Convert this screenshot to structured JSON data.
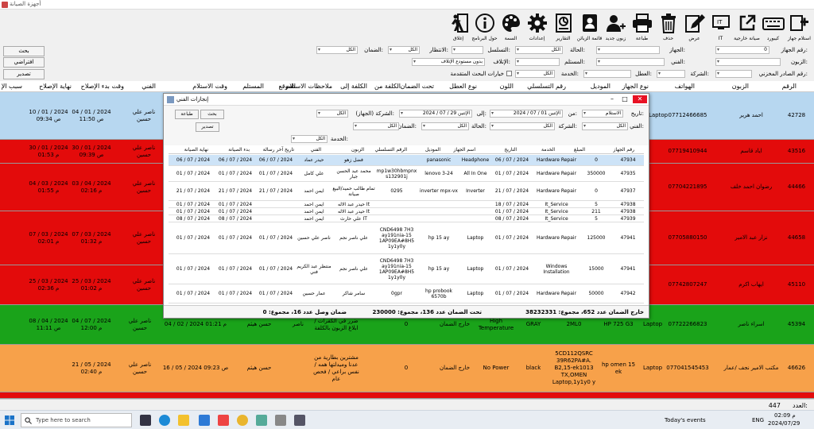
{
  "window": {
    "title": "أجهزة الصيانة"
  },
  "toolbar": [
    {
      "label": "استلام جهاز",
      "icon": "add-plus-icon"
    },
    {
      "label": "كيبورد",
      "icon": "keyboard-icon"
    },
    {
      "label": "صيانة خارجية",
      "icon": "external-link-icon"
    },
    {
      "label": "IT",
      "icon": "it-monitor-icon"
    },
    {
      "label": "عرض",
      "icon": "edit-pen-icon"
    },
    {
      "label": "حذف",
      "icon": "trash-icon"
    },
    {
      "label": "طباعة",
      "icon": "printer-icon"
    },
    {
      "label": "زبون جديد",
      "icon": "add-user-icon"
    },
    {
      "label": "قائمة الزبائن",
      "icon": "contacts-icon"
    },
    {
      "label": "التقارير",
      "icon": "report-chart-icon"
    },
    {
      "label": "إعدادات",
      "icon": "gear-icon"
    },
    {
      "label": "السمة",
      "icon": "palette-icon"
    },
    {
      "label": "حول البرنامج",
      "icon": "info-icon"
    },
    {
      "label": "إغلاق",
      "icon": "exit-door-icon"
    }
  ],
  "filters": {
    "search_btn": "بحث",
    "default_btn": "افتراضي",
    "export_btn": "تصدير",
    "device_no_label": "رقم الجهاز:",
    "device_no_value": "0",
    "device_label": "الجهاز:",
    "status_label": "الحالة:",
    "status_value": "الكل",
    "sequence_label": "التسلسل:",
    "wait_label": "الانتظار:",
    "wait_value": "الكل",
    "warranty_label": "الضمان:",
    "warranty_value": "الكل",
    "customer_label": "الزبون:",
    "technician_label": "الفني:",
    "receiver_label": "المستلم:",
    "destroy_label": "الإتلاف:",
    "destroy_value": "بدون مستودع الإتلاف",
    "internal_no_label": "رقم الصادر المخزني:",
    "company_label": "الشركة:",
    "fault_label": "العطل:",
    "service_label": "الخدمة:",
    "service_value": "الكل",
    "advanced_label": "خيارات البحث المتقدمة"
  },
  "grid_headers": [
    "الرقم",
    "الزبون",
    "الهواتف",
    "نوع الجهاز",
    "الموديل",
    "رقم التسلسلي",
    "اللون",
    "نوع العطل",
    "تحت الضمان",
    "الكلفة من",
    "الكلفة إلى",
    "ملاحظات الاستلام",
    "الموقع",
    "المستلم",
    "وقت الاستلام",
    "الفني",
    "وقت بدء الإصلاح",
    "نهاية الإصلاح",
    "سبب الإ"
  ],
  "grid_rows": [
    {
      "color": "blue",
      "num": "42728",
      "customer": "احمد هرير",
      "phone": "07712466685",
      "type": "Laptop",
      "tech": "ناصر علي حسين",
      "start": "04 / 01 / 2024 11:50 ص",
      "end": "10 / 01 / 2024 09:34 ص"
    },
    {
      "color": "red",
      "num": "43516",
      "customer": "اياد قاسم",
      "phone": "07719410944",
      "type": "Laptop",
      "tech": "ناصر علي حسين",
      "start": "30 / 01 / 2024 09:39 ص",
      "end": "30 / 01 / 2024 01:53 م"
    },
    {
      "color": "red",
      "num": "44466",
      "customer": "رضوان احمد خلف",
      "phone": "07704221895",
      "type": "Laptop",
      "tech": "ناصر علي حسين",
      "start": "03 / 04 / 2024 02:16 م",
      "end": "04 / 03 / 2024 01:55 م"
    },
    {
      "color": "red",
      "num": "44658",
      "customer": "نزار عبد الامير",
      "phone": "07705880150",
      "type": "Laptop",
      "tech": "ناصر علي حسين",
      "start": "07 / 03 / 2024 01:32 م",
      "end": "07 / 03 / 2024 02:01 م"
    },
    {
      "color": "red",
      "num": "45110",
      "customer": "ايهاب اكرم",
      "phone": "07742807247",
      "type": "Laptop",
      "tech": "ناصر علي حسين",
      "start": "25 / 03 / 2024 01:02 م",
      "end": "25 / 03 / 2024 02:36 م"
    },
    {
      "color": "green",
      "num": "45394",
      "customer": "اسراء ناصر",
      "phone": "07722266823",
      "type": "Laptop",
      "model": "HP 725 G3",
      "serial": "2ML0",
      "colorv": "GRAY",
      "fault": "High Temperature",
      "warranty": "خارج الضمان",
      "cost": "0",
      "note": "ضرر في الكفرات / ابلاغ الزبون بالكلفة",
      "receiver": "حسن هيثم",
      "recv_time": "04 / 02 / 2024 01:21 م",
      "tech": "ناصر",
      "tech2": "ناصر علي حسين",
      "start": "04 / 07 / 2024 12:00 م",
      "end": "08 / 04 / 2024 11:11 ص"
    },
    {
      "color": "orange",
      "num": "46626",
      "customer": "مكتب الامير نجف /عمار",
      "phone": "077041545453",
      "type": "Laptop",
      "model": "hp omen 15 ek",
      "serial": "5CD112QSRC 39R62PA#A. B2,15-ek1013 TX,OMEN Laptop,1y1y0 y",
      "colorv": "black",
      "fault": "No Power",
      "warranty": "خارج الضمان",
      "cost": "0",
      "note": "مشترين بطارية من عدنا وميدلتها همه / نفس براعي / فحص عام",
      "receiver": "حسن هيثم",
      "recv_time": "16 / 05 / 2024 09:23 ص",
      "tech2": "ناصر علي حسين",
      "start": "21 / 05 / 2024 02:40 م"
    }
  ],
  "count": {
    "label": "العدد:",
    "value": "447"
  },
  "dialog": {
    "title": "إنجازات الفني",
    "search_btn": "بحث",
    "print_btn": "طباعة",
    "export_btn": "تصدير",
    "date_label": "تاريخ:",
    "date_value": "الاستلام",
    "from_label": "من:",
    "from_value": "الإثنين 01 / 07 / 2024",
    "to_label": "إلى:",
    "to_value": "الإثنين 29 / 07 / 2024",
    "company_device_label": "الشركة (الجهاز):",
    "company_device_value": "الكل",
    "technician_label": "الفني:",
    "technician_value": "الكل",
    "company_label": "الشركة:",
    "company_value": "الكل",
    "status_label": "الحالة:",
    "status_value": "الكل",
    "warranty_label": "الضمان:",
    "warranty_value": "الكل",
    "service_label": "الخدمة:",
    "service_value": "الكل",
    "headers": [
      "رقم الجهاز",
      "المبلغ",
      "الخدمة",
      "التاريخ",
      "اسم الجهاز",
      "الموديل",
      "الرقم التسلسلي",
      "الزبون",
      "الفني",
      "تاريخ آخر رسالة",
      "بدء الصيانة",
      "نهاية الصيانة"
    ],
    "rows": [
      {
        "num": "47934",
        "amount": "0",
        "service": "Hardware Repair",
        "date": "06 / 07 / 2024",
        "device": "Headphone",
        "model": "panasonic",
        "serial": "",
        "customer": "فضل زهو",
        "tech": "حيدر عماد",
        "msg": "06 / 07 / 2024",
        "start": "06 / 07 / 2024",
        "end": "06 / 07 / 2024",
        "sel": true
      },
      {
        "num": "47935",
        "amount": "350000",
        "service": "Hardware Repair",
        "date": "01 / 07 / 2024",
        "device": "All In One",
        "model": "lenovo 3-24",
        "serial": "mp1w30hbmpnx s132901j",
        "customer": "محمد عبد الحسن جبار",
        "tech": "علي كامل",
        "msg": "01 / 07 / 2024",
        "start": "01 / 07 / 2024",
        "end": "01 / 07 / 2024"
      },
      {
        "num": "47937",
        "amount": "0",
        "service": "Hardware Repair",
        "date": "21 / 07 / 2024",
        "device": "Inverter",
        "model": "inverter mpx-vx",
        "serial": "0295",
        "customer": "تمام طالب حميد/البيع صيانة",
        "tech": "ايمن احمد",
        "msg": "21 / 07 / 2024",
        "start": "21 / 07 / 2024",
        "end": "21 / 07 / 2024"
      },
      {
        "num": "47938",
        "amount": "5",
        "service": "It_Service",
        "date": "18 / 07 / 2024",
        "device": "",
        "model": "",
        "serial": "",
        "customer": "حيدر عبد الاله It",
        "tech": "ايمن احمد",
        "msg": "",
        "start": "01 / 07 / 2024",
        "end": "01 / 07 / 2024"
      },
      {
        "num": "47938",
        "amount": "211",
        "service": "It_Service",
        "date": "01 / 07 / 2024",
        "device": "",
        "model": "",
        "serial": "",
        "customer": "حيدر عبد الاله It",
        "tech": "ايمن احمد",
        "msg": "",
        "start": "01 / 07 / 2024",
        "end": "01 / 07 / 2024"
      },
      {
        "num": "47939",
        "amount": "5",
        "service": "It_Service",
        "date": "08 / 07 / 2024",
        "device": "",
        "model": "",
        "serial": "",
        "customer": "علي حارث IT",
        "tech": "ايمن احمد",
        "msg": "",
        "start": "08 / 07 / 2024",
        "end": "08 / 07 / 2024"
      },
      {
        "num": "47941",
        "amount": "125000",
        "service": "Hardware Repair",
        "date": "01 / 07 / 2024",
        "device": "Laptop",
        "model": "hp 15 ay",
        "serial": "CND6498 7H3 ay191nia-15 1AP09EA#8H5 1y1y0y",
        "customer": "علي ناصر نجم",
        "tech": "ناصر علي حسين",
        "msg": "01 / 07 / 2024",
        "start": "01 / 07 / 2024",
        "end": "01 / 07 / 2024"
      },
      {
        "num": "47941",
        "amount": "15000",
        "service": "Windows Installation",
        "date": "01 / 07 / 2024",
        "device": "Laptop",
        "model": "hp 15 ay",
        "serial": "CND6498 7H3 ay191nia-15 1AP09EA#8H5 1y1y0y",
        "customer": "علي ناصر نجم",
        "tech": "منتظر عبد الكريم فني",
        "msg": "01 / 07 / 2024",
        "start": "01 / 07 / 2024",
        "end": "01 / 07 / 2024"
      },
      {
        "num": "47942",
        "amount": "50000",
        "service": "Hardware Repair",
        "date": "01 / 07 / 2024",
        "device": "Laptop",
        "model": "hp probook 6570b",
        "serial": "0gpr",
        "customer": "سامر شاكر",
        "tech": "عمار حسين",
        "msg": "01 / 07 / 2024",
        "start": "01 / 07 / 2024",
        "end": "01 / 07 / 2024"
      }
    ],
    "footer_total": "خارج الضمان عدد 652، مجموع: 38232331",
    "footer_warranty": "تحت الضمان عدد 136، مجموع: 230000",
    "footer_returned": "ضمان وصل عدد 16، مجموع: 0"
  },
  "taskbar": {
    "search_placeholder": "Type here to search",
    "news": "Today's events",
    "lang": "ENG",
    "time": "02:09 م",
    "date": "2024/07/29"
  }
}
